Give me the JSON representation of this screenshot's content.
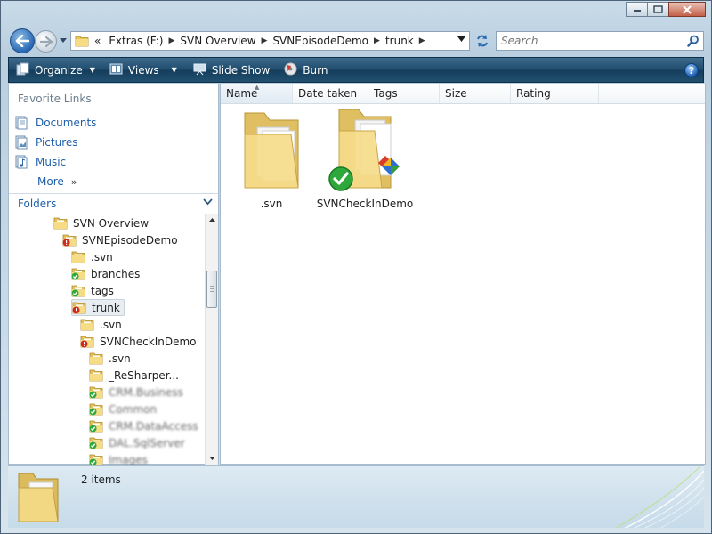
{
  "window": {
    "caption_buttons": [
      "minimize",
      "maximize",
      "close"
    ]
  },
  "address": {
    "chevron": "«",
    "crumbs": [
      "Extras (F:)",
      "SVN Overview",
      "SVNEpisodeDemo",
      "trunk"
    ],
    "search_placeholder": "Search"
  },
  "toolbar": {
    "items": [
      {
        "label": "Organize",
        "icon": "organize-icon",
        "dropdown": true
      },
      {
        "label": "Views",
        "icon": "views-icon",
        "dropdown": true
      },
      {
        "label": "Slide Show",
        "icon": "slideshow-icon",
        "dropdown": false
      },
      {
        "label": "Burn",
        "icon": "burn-icon",
        "dropdown": false
      }
    ],
    "help": "?"
  },
  "sidebar": {
    "favorites_title": "Favorite Links",
    "favorites": [
      "Documents",
      "Pictures",
      "Music",
      "More"
    ],
    "more_glyph": "»",
    "folders_title": "Folders",
    "tree": [
      {
        "label": "SVN Overview",
        "overlay": "none"
      },
      {
        "label": "SVNEpisodeDemo",
        "overlay": "modified"
      },
      {
        "label": ".svn",
        "overlay": "none"
      },
      {
        "label": "branches",
        "overlay": "ok"
      },
      {
        "label": "tags",
        "overlay": "ok"
      },
      {
        "label": "trunk",
        "overlay": "modified"
      },
      {
        "label": ".svn",
        "overlay": "none"
      },
      {
        "label": "SVNCheckInDemo",
        "overlay": "modified"
      },
      {
        "label": ".svn",
        "overlay": "none"
      },
      {
        "label": "_ReSharper...",
        "overlay": "none"
      },
      {
        "label": "CRM.Business",
        "overlay": "ok"
      },
      {
        "label": "Common",
        "overlay": "ok"
      },
      {
        "label": "CRM.DataAccess",
        "overlay": "ok"
      },
      {
        "label": "DAL.SqlServer",
        "overlay": "ok"
      },
      {
        "label": "Images",
        "overlay": "ok"
      }
    ]
  },
  "main": {
    "columns": [
      "Name",
      "Date taken",
      "Tags",
      "Size",
      "Rating"
    ],
    "sorted_column": "Name",
    "files": [
      {
        "name": ".svn",
        "overlay": "none",
        "has_content_badge": false
      },
      {
        "name": "SVNCheckInDemo",
        "overlay": "ok",
        "has_content_badge": true
      }
    ]
  },
  "details": {
    "count_text": "2 items"
  },
  "colors": {
    "toolbar": "#1f4b6d",
    "link": "#1f5fa8",
    "folder": "#f2d77b",
    "ok_overlay": "#2ea83a",
    "modified_overlay": "#cc2b1d"
  }
}
